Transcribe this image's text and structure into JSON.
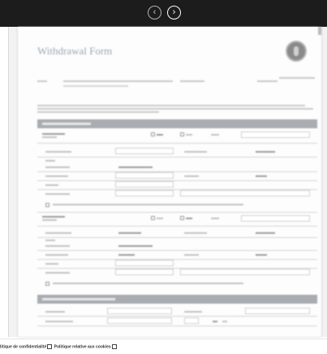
{
  "toolbar": {
    "prev_icon": "‹",
    "next_icon": "›"
  },
  "document": {
    "title": "Withdrawal Form"
  },
  "footer": {
    "privacy_link": "litique de confidentialité",
    "cookies_link": "Politique relative aux cookies"
  }
}
